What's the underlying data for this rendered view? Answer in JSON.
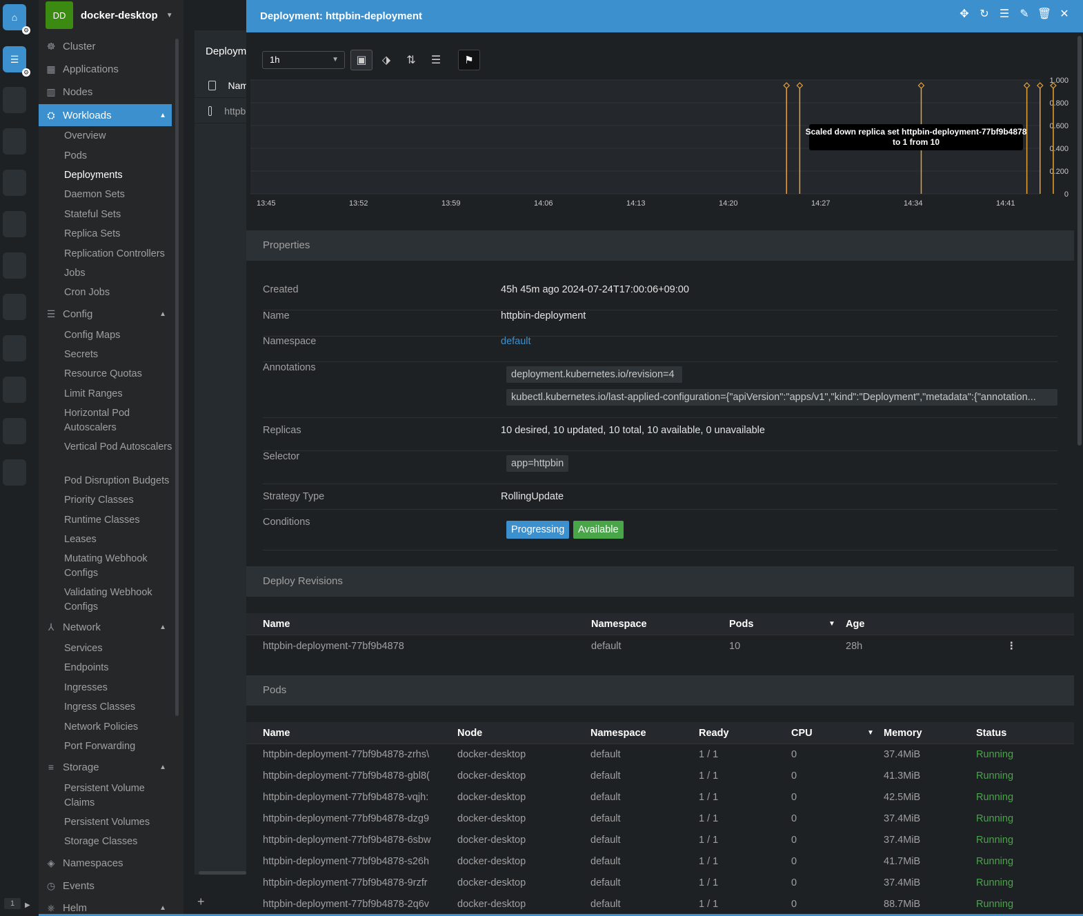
{
  "cluster": {
    "initials": "DD",
    "name": "docker-desktop"
  },
  "hotbar": {
    "page": "1"
  },
  "sidebar": {
    "top": [
      {
        "label": "Cluster",
        "icon": "cluster-icon",
        "glyph": "☸"
      },
      {
        "label": "Applications",
        "icon": "applications-icon",
        "glyph": "▦"
      },
      {
        "label": "Nodes",
        "icon": "nodes-icon",
        "glyph": "▥"
      },
      {
        "label": "Workloads",
        "icon": "workloads-icon",
        "glyph": "⛭"
      }
    ],
    "workloads": [
      "Overview",
      "Pods",
      "Deployments",
      "Daemon Sets",
      "Stateful Sets",
      "Replica Sets",
      "Replication Controllers",
      "Jobs",
      "Cron Jobs"
    ],
    "config_label": "Config",
    "config": [
      "Config Maps",
      "Secrets",
      "Resource Quotas",
      "Limit Ranges",
      "Horizontal Pod Autoscalers",
      "Vertical Pod Autoscalers",
      "Pod Disruption Budgets",
      "Priority Classes",
      "Runtime Classes",
      "Leases",
      "Mutating Webhook Configs",
      "Validating Webhook Configs"
    ],
    "network_label": "Network",
    "network": [
      "Services",
      "Endpoints",
      "Ingresses",
      "Ingress Classes",
      "Network Policies",
      "Port Forwarding"
    ],
    "storage_label": "Storage",
    "storage": [
      "Persistent Volume Claims",
      "Persistent Volumes",
      "Storage Classes"
    ],
    "namespaces_label": "Namespaces",
    "events_label": "Events",
    "helm_label": "Helm"
  },
  "list": {
    "title": "Deployments",
    "col_name": "Name",
    "row": "httpbin-deployment"
  },
  "drawer": {
    "title": "Deployment: httpbin-deployment",
    "range": "1h",
    "tooltip_line1": "Scaled down replica set httpbin-deployment-77bf9b4878",
    "tooltip_line2": "to 1 from 10"
  },
  "chart_data": {
    "type": "scatter",
    "title": "",
    "x_ticks": [
      "13:45",
      "13:52",
      "13:59",
      "14:06",
      "14:13",
      "14:20",
      "14:27",
      "14:34",
      "14:41"
    ],
    "y_ticks": [
      "1.000",
      "0.800",
      "0.600",
      "0.400",
      "0.200",
      "0"
    ],
    "ylim": [
      0,
      1
    ],
    "events_minutes_after_1345": [
      39.4,
      40.4,
      49.6,
      57.6,
      58.6,
      59.6
    ],
    "event_value": 1,
    "color": "#e8a33b"
  },
  "properties": {
    "heading": "Properties",
    "created_label": "Created",
    "created": "45h 45m ago 2024-07-24T17:00:06+09:00",
    "name_label": "Name",
    "name": "httpbin-deployment",
    "namespace_label": "Namespace",
    "namespace": "default",
    "annotations_label": "Annotations",
    "annotation1": "deployment.kubernetes.io/revision=4",
    "annotation2": "kubectl.kubernetes.io/last-applied-configuration={\"apiVersion\":\"apps/v1\",\"kind\":\"Deployment\",\"metadata\":{\"annotation...",
    "replicas_label": "Replicas",
    "replicas": "10 desired, 10 updated, 10 total, 10 available, 0 unavailable",
    "selector_label": "Selector",
    "selector": "app=httpbin",
    "strategy_label": "Strategy Type",
    "strategy": "RollingUpdate",
    "conditions_label": "Conditions",
    "cond1": "Progressing",
    "cond2": "Available",
    "cond1_color": "#3d90ce",
    "cond2_color": "#48a548"
  },
  "revisions": {
    "heading": "Deploy Revisions",
    "cols": [
      "Name",
      "Namespace",
      "Pods",
      "Age"
    ],
    "row": [
      "httpbin-deployment-77bf9b4878",
      "default",
      "10",
      "28h"
    ]
  },
  "pods": {
    "heading": "Pods",
    "cols": [
      "Name",
      "Node",
      "Namespace",
      "Ready",
      "CPU",
      "Memory",
      "Status"
    ],
    "rows": [
      [
        "httpbin-deployment-77bf9b4878-zrhs\\",
        "docker-desktop",
        "default",
        "1 / 1",
        "0",
        "37.4MiB",
        "Running"
      ],
      [
        "httpbin-deployment-77bf9b4878-gbl8(",
        "docker-desktop",
        "default",
        "1 / 1",
        "0",
        "41.3MiB",
        "Running"
      ],
      [
        "httpbin-deployment-77bf9b4878-vqjh:",
        "docker-desktop",
        "default",
        "1 / 1",
        "0",
        "42.5MiB",
        "Running"
      ],
      [
        "httpbin-deployment-77bf9b4878-dzg9",
        "docker-desktop",
        "default",
        "1 / 1",
        "0",
        "37.4MiB",
        "Running"
      ],
      [
        "httpbin-deployment-77bf9b4878-6sbw",
        "docker-desktop",
        "default",
        "1 / 1",
        "0",
        "37.4MiB",
        "Running"
      ],
      [
        "httpbin-deployment-77bf9b4878-s26h",
        "docker-desktop",
        "default",
        "1 / 1",
        "0",
        "41.7MiB",
        "Running"
      ],
      [
        "httpbin-deployment-77bf9b4878-9rzfr",
        "docker-desktop",
        "default",
        "1 / 1",
        "0",
        "37.4MiB",
        "Running"
      ],
      [
        "httpbin-deployment-77bf9b4878-2q6v",
        "docker-desktop",
        "default",
        "1 / 1",
        "0",
        "88.7MiB",
        "Running"
      ]
    ]
  }
}
